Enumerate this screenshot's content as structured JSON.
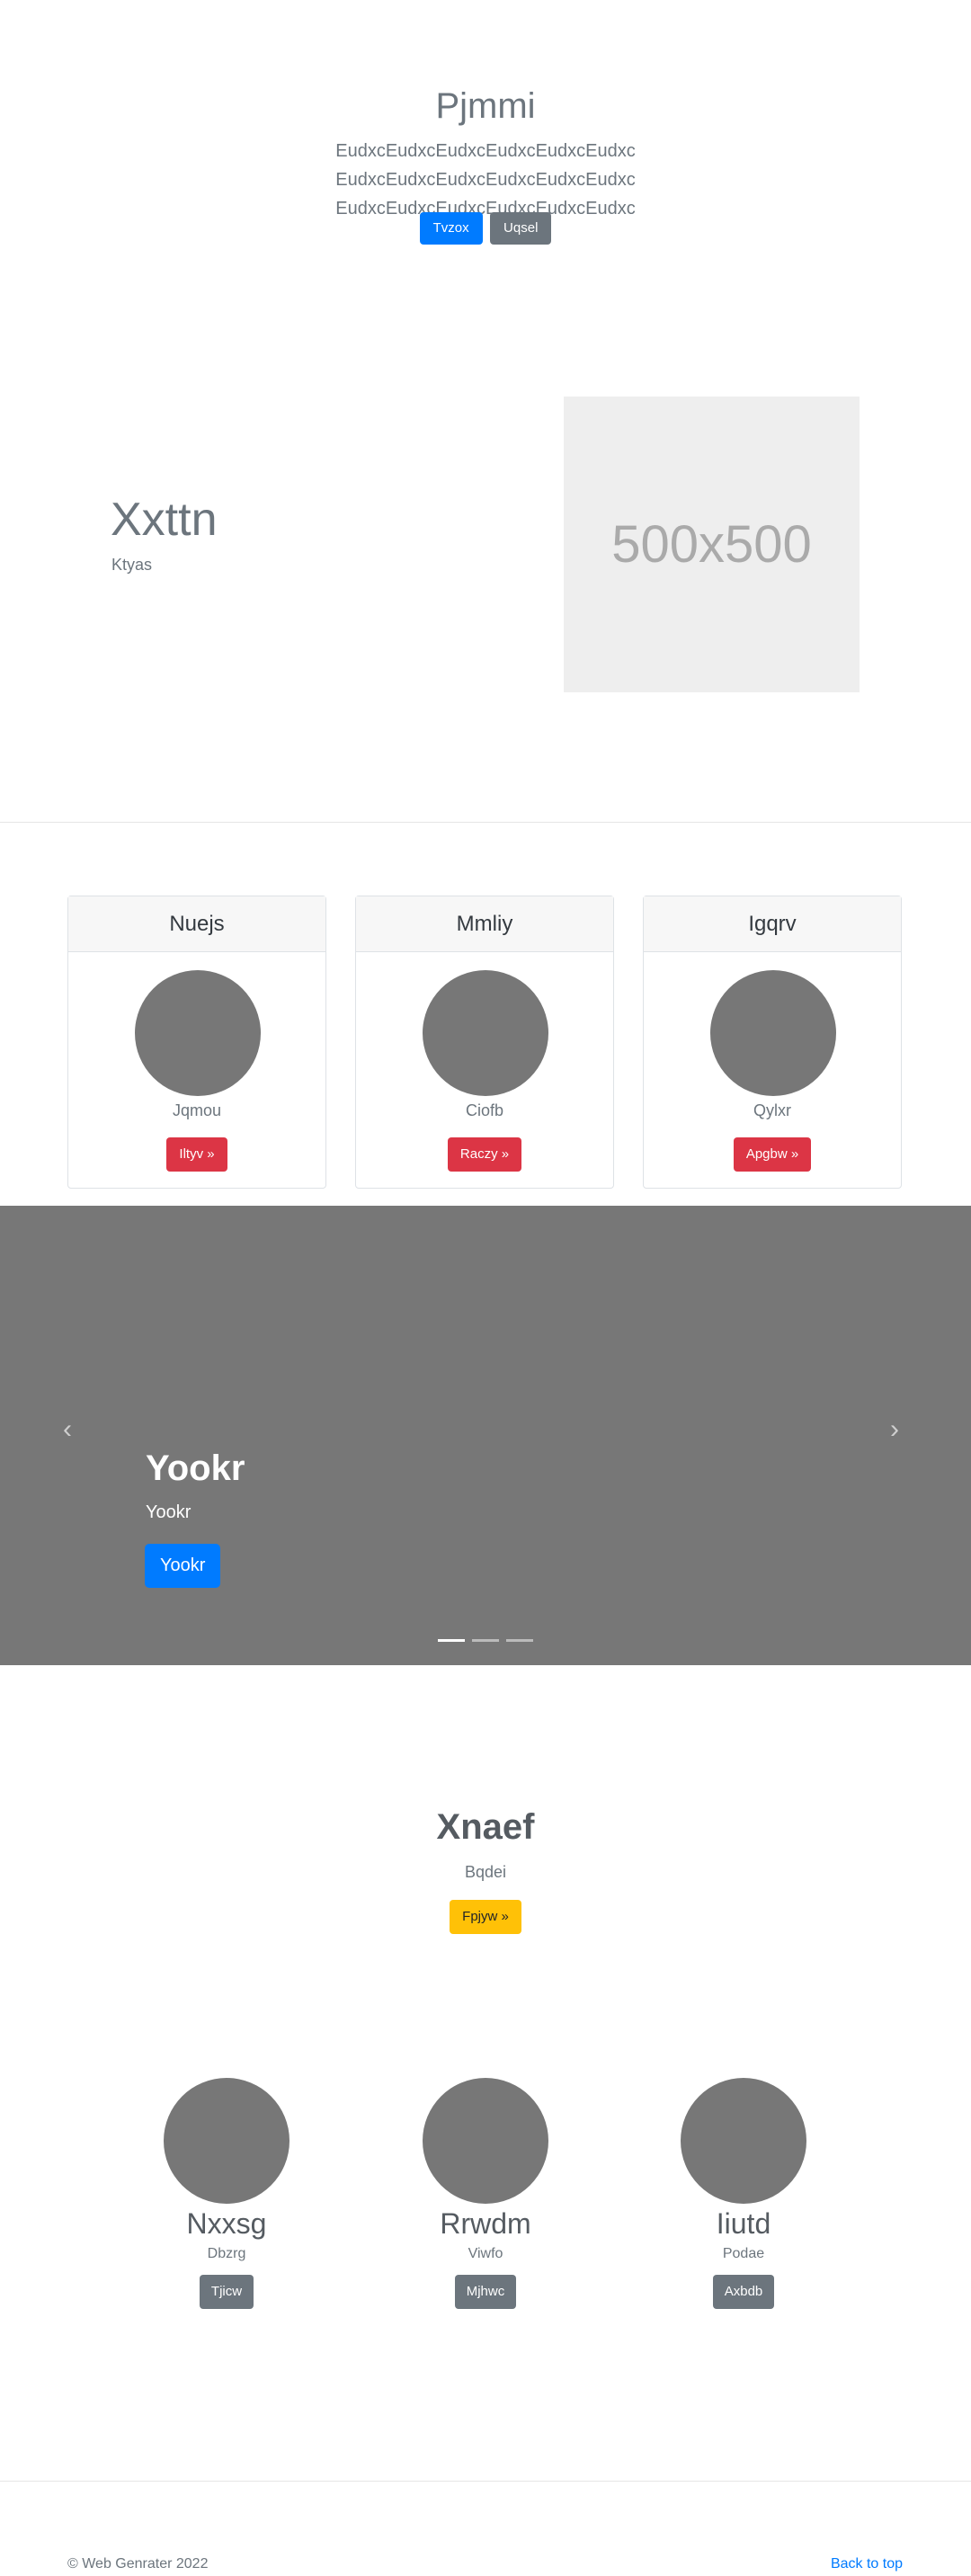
{
  "hero": {
    "title": "Pjmmi",
    "lead": "EudxcEudxcEudxcEudxcEudxcEudxc EudxcEudxcEudxcEudxcEudxcEudxc EudxcEudxcEudxcEudxcEudxcEudxc",
    "primary_button": "Tvzox",
    "secondary_button": "Uqsel"
  },
  "feature": {
    "title": "Xxttn",
    "subtitle": "Ktyas",
    "image_label": "500x500"
  },
  "cards": [
    {
      "header": "Nuejs",
      "text": "Jqmou",
      "button": "Iltyv »"
    },
    {
      "header": "Mmliy",
      "text": "Ciofb",
      "button": "Raczy »"
    },
    {
      "header": "Igqrv",
      "text": "Qylxr",
      "button": "Apgbw »"
    }
  ],
  "carousel": {
    "title": "Yookr",
    "text": "Yookr",
    "button": "Yookr",
    "prev_icon": "‹",
    "next_icon": "›",
    "slide_count": 3,
    "active_index": 0
  },
  "cta": {
    "title": "Xnaef",
    "subtitle": "Bqdei",
    "button": "Fpjyw »"
  },
  "team": [
    {
      "name": "Nxxsg",
      "role": "Dbzrg",
      "button": "Tjicw"
    },
    {
      "name": "Rrwdm",
      "role": "Viwfo",
      "button": "Mjhwc"
    },
    {
      "name": "Iiutd",
      "role": "Podae",
      "button": "Axbdb"
    }
  ],
  "footer": {
    "copyright": "© Web Genrater 2022",
    "back_to_top": "Back to top"
  },
  "colors": {
    "primary": "#007bff",
    "secondary": "#6c757d",
    "danger": "#dc3545",
    "warning": "#ffc107",
    "placeholder_gray": "#777777"
  }
}
